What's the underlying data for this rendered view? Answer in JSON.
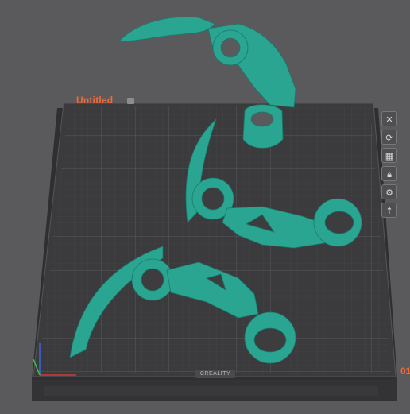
{
  "plate": {
    "name": "Untitled",
    "index": "01",
    "brand": "CREALITY"
  },
  "toolbar": {
    "tools": [
      {
        "name": "delete-plate",
        "icon": "close-icon"
      },
      {
        "name": "auto-orient",
        "icon": "orient-icon"
      },
      {
        "name": "arrange",
        "icon": "arrange-icon"
      },
      {
        "name": "lock",
        "icon": "lock-icon"
      },
      {
        "name": "plate-settings",
        "icon": "settings-icon"
      },
      {
        "name": "move-up",
        "icon": "upload-icon"
      }
    ]
  },
  "colors": {
    "model": "#2aa592",
    "accent": "#ee6a3a",
    "bed": "#3a3a3c",
    "grid": "#4b4b4e"
  }
}
